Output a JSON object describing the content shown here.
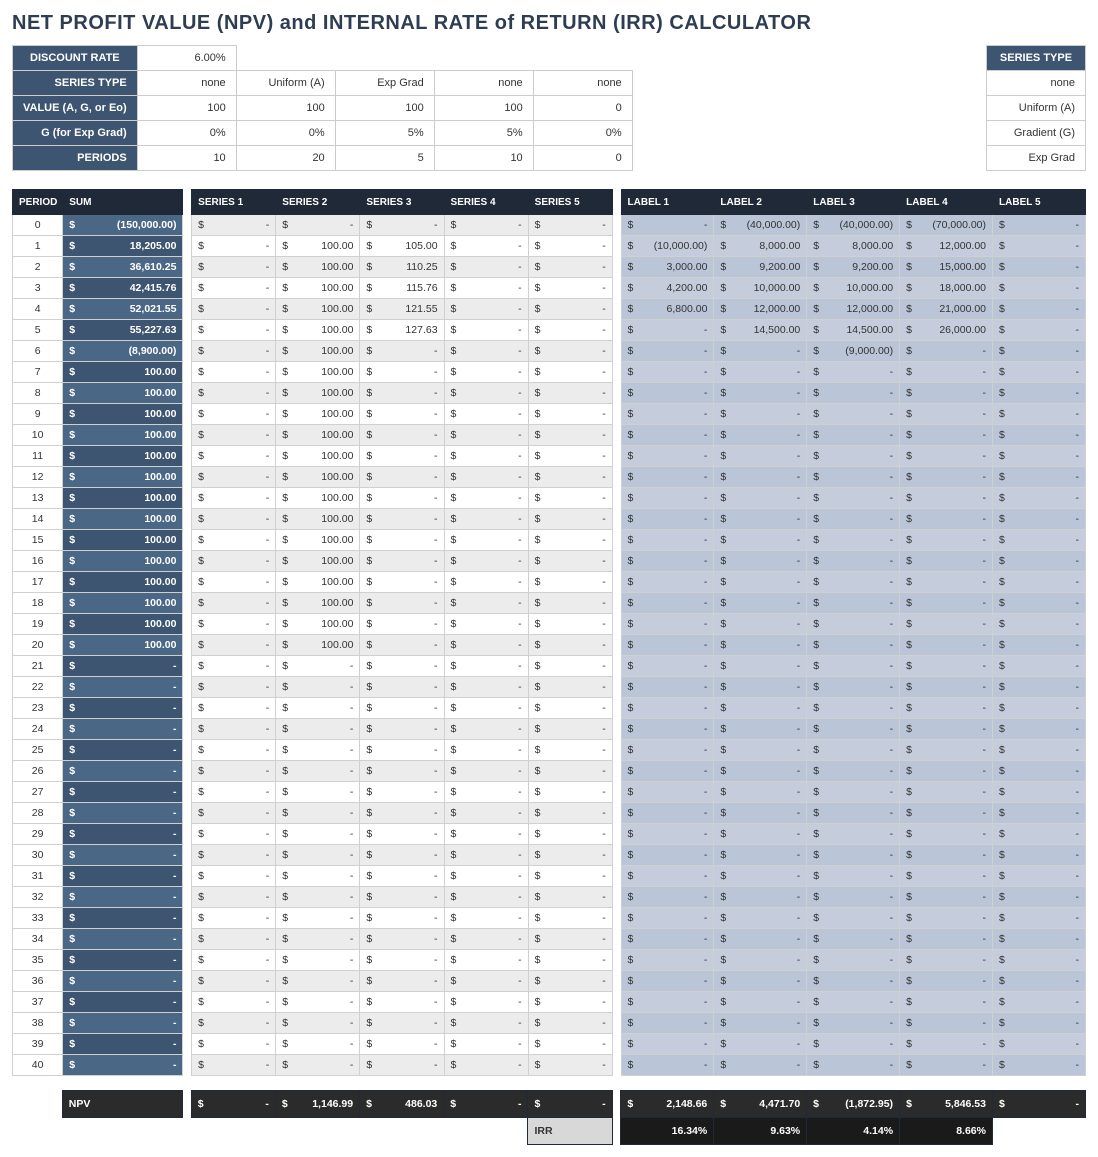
{
  "title": "NET PROFIT VALUE (NPV) and INTERNAL RATE of RETURN (IRR) CALCULATOR",
  "params": {
    "headers": [
      "DISCOUNT RATE",
      "SERIES TYPE",
      "VALUE (A, G, or Eo)",
      "G (for Exp Grad)",
      "PERIODS"
    ],
    "discount_rate": "6.00%",
    "rows": {
      "series_type": [
        "none",
        "Uniform (A)",
        "Exp Grad",
        "none",
        "none"
      ],
      "value": [
        "100",
        "100",
        "100",
        "100",
        "0"
      ],
      "g": [
        "0%",
        "0%",
        "5%",
        "5%",
        "0%"
      ],
      "periods": [
        "10",
        "20",
        "5",
        "10",
        "0"
      ]
    }
  },
  "legend": {
    "header": "SERIES TYPE",
    "items": [
      "none",
      "Uniform (A)",
      "Gradient (G)",
      "Exp Grad"
    ]
  },
  "grid": {
    "headers": {
      "period": "PERIOD",
      "sum": "SUM",
      "series": [
        "SERIES 1",
        "SERIES 2",
        "SERIES 3",
        "SERIES 4",
        "SERIES 5"
      ],
      "labels": [
        "LABEL 1",
        "LABEL 2",
        "LABEL 3",
        "LABEL 4",
        "LABEL 5"
      ]
    },
    "currency": "$",
    "period_count": 41,
    "sum": [
      "(150,000.00)",
      "18,205.00",
      "36,610.25",
      "42,415.76",
      "52,021.55",
      "55,227.63",
      "(8,900.00)",
      "100.00",
      "100.00",
      "100.00",
      "100.00",
      "100.00",
      "100.00",
      "100.00",
      "100.00",
      "100.00",
      "100.00",
      "100.00",
      "100.00",
      "100.00",
      "100.00",
      "-",
      "-",
      "-",
      "-",
      "-",
      "-",
      "-",
      "-",
      "-",
      "-",
      "-",
      "-",
      "-",
      "-",
      "-",
      "-",
      "-",
      "-",
      "-",
      "-"
    ],
    "series": [
      [
        "-",
        "-",
        "-",
        "-",
        "-",
        "-",
        "-",
        "-",
        "-",
        "-",
        "-",
        "-",
        "-",
        "-",
        "-",
        "-",
        "-",
        "-",
        "-",
        "-",
        "-",
        "-",
        "-",
        "-",
        "-",
        "-",
        "-",
        "-",
        "-",
        "-",
        "-",
        "-",
        "-",
        "-",
        "-",
        "-",
        "-",
        "-",
        "-",
        "-",
        "-"
      ],
      [
        "-",
        "100.00",
        "100.00",
        "100.00",
        "100.00",
        "100.00",
        "100.00",
        "100.00",
        "100.00",
        "100.00",
        "100.00",
        "100.00",
        "100.00",
        "100.00",
        "100.00",
        "100.00",
        "100.00",
        "100.00",
        "100.00",
        "100.00",
        "100.00",
        "-",
        "-",
        "-",
        "-",
        "-",
        "-",
        "-",
        "-",
        "-",
        "-",
        "-",
        "-",
        "-",
        "-",
        "-",
        "-",
        "-",
        "-",
        "-",
        "-"
      ],
      [
        "-",
        "105.00",
        "110.25",
        "115.76",
        "121.55",
        "127.63",
        "-",
        "-",
        "-",
        "-",
        "-",
        "-",
        "-",
        "-",
        "-",
        "-",
        "-",
        "-",
        "-",
        "-",
        "-",
        "-",
        "-",
        "-",
        "-",
        "-",
        "-",
        "-",
        "-",
        "-",
        "-",
        "-",
        "-",
        "-",
        "-",
        "-",
        "-",
        "-",
        "-",
        "-",
        "-"
      ],
      [
        "-",
        "-",
        "-",
        "-",
        "-",
        "-",
        "-",
        "-",
        "-",
        "-",
        "-",
        "-",
        "-",
        "-",
        "-",
        "-",
        "-",
        "-",
        "-",
        "-",
        "-",
        "-",
        "-",
        "-",
        "-",
        "-",
        "-",
        "-",
        "-",
        "-",
        "-",
        "-",
        "-",
        "-",
        "-",
        "-",
        "-",
        "-",
        "-",
        "-",
        "-"
      ],
      [
        "-",
        "-",
        "-",
        "-",
        "-",
        "-",
        "-",
        "-",
        "-",
        "-",
        "-",
        "-",
        "-",
        "-",
        "-",
        "-",
        "-",
        "-",
        "-",
        "-",
        "-",
        "-",
        "-",
        "-",
        "-",
        "-",
        "-",
        "-",
        "-",
        "-",
        "-",
        "-",
        "-",
        "-",
        "-",
        "-",
        "-",
        "-",
        "-",
        "-",
        "-"
      ]
    ],
    "labels": [
      [
        "-",
        "(10,000.00)",
        "3,000.00",
        "4,200.00",
        "6,800.00",
        "-",
        "-",
        "-",
        "-",
        "-",
        "-",
        "-",
        "-",
        "-",
        "-",
        "-",
        "-",
        "-",
        "-",
        "-",
        "-",
        "-",
        "-",
        "-",
        "-",
        "-",
        "-",
        "-",
        "-",
        "-",
        "-",
        "-",
        "-",
        "-",
        "-",
        "-",
        "-",
        "-",
        "-",
        "-",
        "-"
      ],
      [
        "(40,000.00)",
        "8,000.00",
        "9,200.00",
        "10,000.00",
        "12,000.00",
        "14,500.00",
        "-",
        "-",
        "-",
        "-",
        "-",
        "-",
        "-",
        "-",
        "-",
        "-",
        "-",
        "-",
        "-",
        "-",
        "-",
        "-",
        "-",
        "-",
        "-",
        "-",
        "-",
        "-",
        "-",
        "-",
        "-",
        "-",
        "-",
        "-",
        "-",
        "-",
        "-",
        "-",
        "-",
        "-",
        "-"
      ],
      [
        "(40,000.00)",
        "8,000.00",
        "9,200.00",
        "10,000.00",
        "12,000.00",
        "14,500.00",
        "(9,000.00)",
        "-",
        "-",
        "-",
        "-",
        "-",
        "-",
        "-",
        "-",
        "-",
        "-",
        "-",
        "-",
        "-",
        "-",
        "-",
        "-",
        "-",
        "-",
        "-",
        "-",
        "-",
        "-",
        "-",
        "-",
        "-",
        "-",
        "-",
        "-",
        "-",
        "-",
        "-",
        "-",
        "-",
        "-"
      ],
      [
        "(70,000.00)",
        "12,000.00",
        "15,000.00",
        "18,000.00",
        "21,000.00",
        "26,000.00",
        "-",
        "-",
        "-",
        "-",
        "-",
        "-",
        "-",
        "-",
        "-",
        "-",
        "-",
        "-",
        "-",
        "-",
        "-",
        "-",
        "-",
        "-",
        "-",
        "-",
        "-",
        "-",
        "-",
        "-",
        "-",
        "-",
        "-",
        "-",
        "-",
        "-",
        "-",
        "-",
        "-",
        "-",
        "-"
      ],
      [
        "-",
        "-",
        "-",
        "-",
        "-",
        "-",
        "-",
        "-",
        "-",
        "-",
        "-",
        "-",
        "-",
        "-",
        "-",
        "-",
        "-",
        "-",
        "-",
        "-",
        "-",
        "-",
        "-",
        "-",
        "-",
        "-",
        "-",
        "-",
        "-",
        "-",
        "-",
        "-",
        "-",
        "-",
        "-",
        "-",
        "-",
        "-",
        "-",
        "-",
        "-"
      ]
    ]
  },
  "bottom": {
    "npv_label": "NPV",
    "npv_series": [
      "-",
      "1,146.99",
      "486.03",
      "-",
      "-"
    ],
    "npv_labels": [
      "2,148.66",
      "4,471.70",
      "(1,872.95)",
      "5,846.53",
      "-"
    ],
    "irr_label": "IRR",
    "irr_values": [
      "16.34%",
      "9.63%",
      "4.14%",
      "8.66%",
      ""
    ]
  }
}
